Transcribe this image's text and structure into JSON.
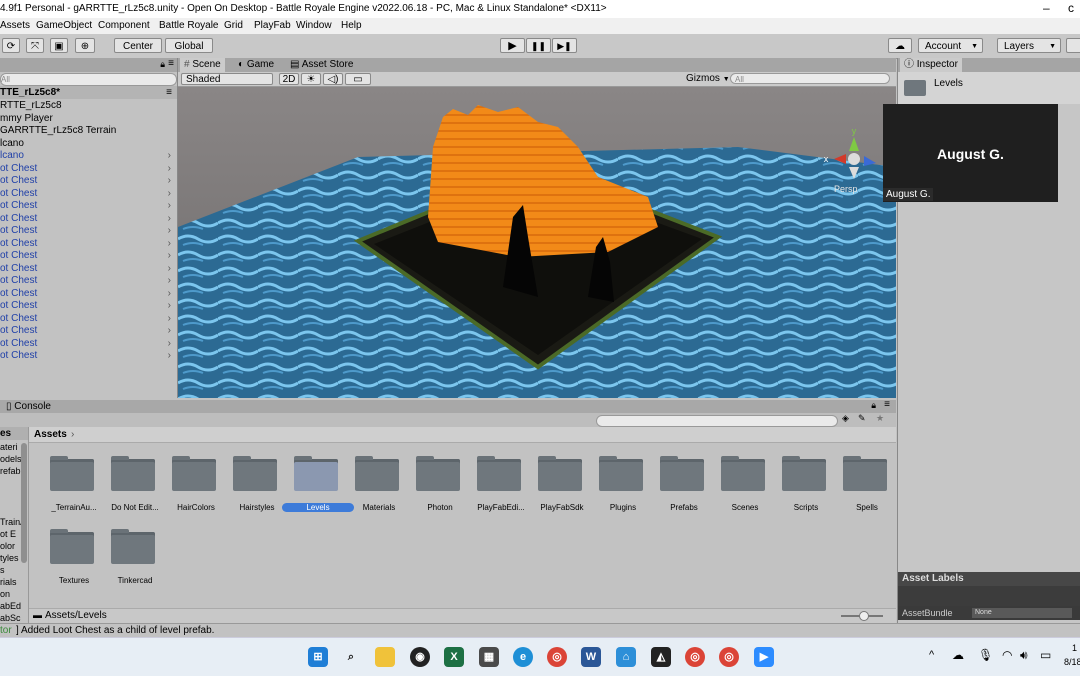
{
  "window": {
    "title": "4.9f1 Personal - gARRTTE_rLz5c8.unity - Open On Desktop - Battle Royale Engine v2022.06.18 - PC, Mac & Linux Standalone* <DX11>",
    "close_glyph": "–",
    "restore_glyph": "c"
  },
  "menu": [
    "Assets",
    "GameObject",
    "Component",
    "Battle Royale",
    "Grid",
    "PlayFab",
    "Window",
    "Help"
  ],
  "toolbar": {
    "pivot_label": "Center",
    "space_label": "Global",
    "account_label": "Account",
    "layers_label": "Layers",
    "play_glyph": "▶",
    "pause_glyph": "❚❚",
    "step_glyph": "▶❚"
  },
  "hierarchy": {
    "search_placeholder": "All",
    "scene_name": "TTE_rLz5c8*",
    "items": [
      {
        "label": "RTTE_rLz5c8",
        "blue": false,
        "chevron": false
      },
      {
        "label": "mmy Player",
        "blue": false,
        "chevron": false
      },
      {
        "label": "GARRTTE_rLz5c8 Terrain",
        "blue": false,
        "chevron": false
      },
      {
        "label": "lcano",
        "blue": false,
        "chevron": false
      },
      {
        "label": "lcano",
        "blue": true,
        "chevron": true
      },
      {
        "label": "ot Chest",
        "blue": true,
        "chevron": true
      },
      {
        "label": "ot Chest",
        "blue": true,
        "chevron": true
      },
      {
        "label": "ot Chest",
        "blue": true,
        "chevron": true
      },
      {
        "label": "ot Chest",
        "blue": true,
        "chevron": true
      },
      {
        "label": "ot Chest",
        "blue": true,
        "chevron": true
      },
      {
        "label": "ot Chest",
        "blue": true,
        "chevron": true
      },
      {
        "label": "ot Chest",
        "blue": true,
        "chevron": true
      },
      {
        "label": "ot Chest",
        "blue": true,
        "chevron": true
      },
      {
        "label": "ot Chest",
        "blue": true,
        "chevron": true
      },
      {
        "label": "ot Chest",
        "blue": true,
        "chevron": true
      },
      {
        "label": "ot Chest",
        "blue": true,
        "chevron": true
      },
      {
        "label": "ot Chest",
        "blue": true,
        "chevron": true
      },
      {
        "label": "ot Chest",
        "blue": true,
        "chevron": true
      },
      {
        "label": "ot Chest",
        "blue": true,
        "chevron": true
      },
      {
        "label": "ot Chest",
        "blue": true,
        "chevron": true
      },
      {
        "label": "ot Chest",
        "blue": true,
        "chevron": true
      }
    ]
  },
  "scene": {
    "tab_scene": "Scene",
    "tab_game": "Game",
    "tab_store": "Asset Store",
    "shading": "Shaded",
    "mode_2d": "2D",
    "gizmos": "Gizmos",
    "search_placeholder": "All",
    "persp_label": "Persp",
    "axis_y": "y",
    "axis_x": "x"
  },
  "inspector": {
    "tab": "Inspector",
    "object_name": "Levels",
    "asset_labels": "Asset Labels",
    "assetbundle_label": "AssetBundle",
    "assetbundle_value": "None"
  },
  "video_overlay": {
    "name_big": "August G.",
    "name_small": "August G."
  },
  "console": {
    "tab": "Console"
  },
  "project": {
    "breadcrumb": "Assets",
    "left_tab": "es",
    "left_items": [
      "ateri",
      "odels",
      "refab",
      "TrainA",
      "ot E",
      "olor",
      "tyles",
      "s",
      "rials",
      "on",
      "abEd",
      "abSc"
    ],
    "folders": [
      "_TerrainAu...",
      "Do Not Edit...",
      "HairColors",
      "Hairstyles",
      "Levels",
      "Materials",
      "Photon",
      "PlayFabEdi...",
      "PlayFabSdk",
      "Plugins",
      "Prefabs",
      "Scenes",
      "Scripts",
      "Spells",
      "Textures",
      "Tinkercad"
    ],
    "selected": "Levels",
    "path": "Assets/Levels"
  },
  "status": {
    "prefix": "tor",
    "message": "] Added Loot Chest as a child of level prefab."
  },
  "taskbar": {
    "icons": [
      "start-icon",
      "search-icon",
      "file-explorer-icon",
      "github-icon",
      "excel-icon",
      "calculator-icon",
      "edge-icon",
      "chrome-icon",
      "word-icon",
      "network-icon",
      "unity-icon",
      "chrome-profile-icon",
      "chrome-notify-icon",
      "zoom-icon"
    ],
    "tray_chevron": "^",
    "date_partial": "8/18",
    "time_partial": "1"
  },
  "colors": {
    "accent": "#3d7bd9",
    "terrain_orange": "#f08a1c",
    "water": "#2d6e9e",
    "hierarchy_blue": "#1f3fa8"
  }
}
